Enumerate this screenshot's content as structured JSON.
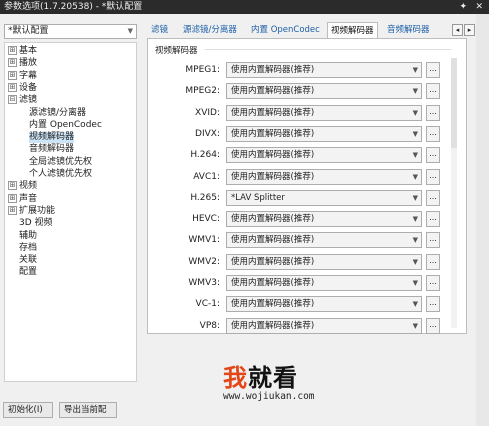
{
  "window": {
    "title": "参数选项(1.7.20538) - *默认配置",
    "pin_icon": "pin-icon",
    "close_icon": "close-icon"
  },
  "sidebar": {
    "preset": "*默认配置",
    "tree": [
      {
        "label": "基本",
        "toggle": "⊞"
      },
      {
        "label": "播放",
        "toggle": "⊞"
      },
      {
        "label": "字幕",
        "toggle": "⊞"
      },
      {
        "label": "设备",
        "toggle": "⊞"
      },
      {
        "label": "滤镜",
        "toggle": "⊟"
      },
      {
        "label": "源滤镜/分离器",
        "toggle": ""
      },
      {
        "label": "内置 OpenCodec",
        "toggle": ""
      },
      {
        "label": "视频解码器",
        "toggle": ""
      },
      {
        "label": "音频解码器",
        "toggle": ""
      },
      {
        "label": "全局滤镜优先权",
        "toggle": ""
      },
      {
        "label": "个人滤镜优先权",
        "toggle": ""
      },
      {
        "label": "视频",
        "toggle": "⊞"
      },
      {
        "label": "声音",
        "toggle": "⊞"
      },
      {
        "label": "扩展功能",
        "toggle": "⊞"
      },
      {
        "label": "3D 视频",
        "toggle": ""
      },
      {
        "label": "辅助",
        "toggle": ""
      },
      {
        "label": "存档",
        "toggle": ""
      },
      {
        "label": "关联",
        "toggle": ""
      },
      {
        "label": "配置",
        "toggle": ""
      }
    ],
    "init_button": "初始化(I)",
    "export_button": "导出当前配"
  },
  "tabs": [
    "滤镜",
    "源滤镜/分离器",
    "内置 OpenCodec",
    "视频解码器",
    "音频解码器"
  ],
  "tab_nav": [
    "◂",
    "▸"
  ],
  "group_title": "视频解码器",
  "decoders": [
    {
      "label": "MPEG1:",
      "value": "使用内置解码器(推荐)"
    },
    {
      "label": "MPEG2:",
      "value": "使用内置解码器(推荐)"
    },
    {
      "label": "XVID:",
      "value": "使用内置解码器(推荐)"
    },
    {
      "label": "DIVX:",
      "value": "使用内置解码器(推荐)"
    },
    {
      "label": "H.264:",
      "value": "使用内置解码器(推荐)"
    },
    {
      "label": "AVC1:",
      "value": "使用内置解码器(推荐)"
    },
    {
      "label": "H.265:",
      "value": "*LAV Splitter"
    },
    {
      "label": "HEVC:",
      "value": "使用内置解码器(推荐)"
    },
    {
      "label": "WMV1:",
      "value": "使用内置解码器(推荐)"
    },
    {
      "label": "WMV2:",
      "value": "使用内置解码器(推荐)"
    },
    {
      "label": "WMV3:",
      "value": "使用内置解码器(推荐)"
    },
    {
      "label": "VC-1:",
      "value": "使用内置解码器(推荐)"
    },
    {
      "label": "VP8:",
      "value": "使用内置解码器(推荐)"
    }
  ],
  "more_button": "...",
  "watermark": {
    "part1": "我",
    "part2": "就看",
    "url": "www.wojiukan.com"
  }
}
